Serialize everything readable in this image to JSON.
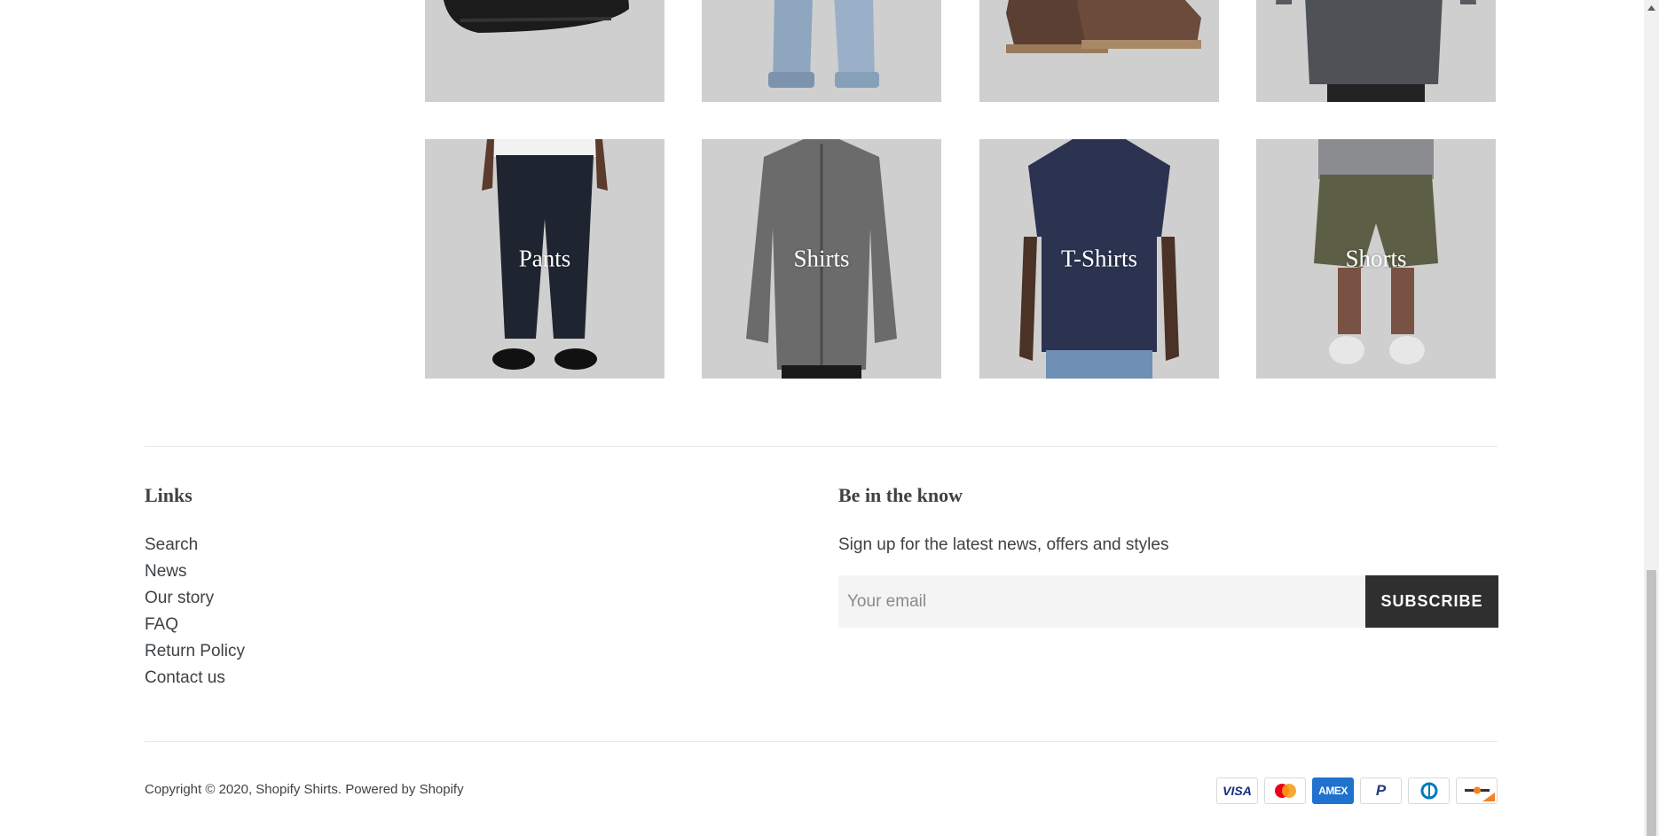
{
  "collections": {
    "row_top": [
      {
        "title": "",
        "image": "bag-photo"
      },
      {
        "title": "",
        "image": "jeans-photo"
      },
      {
        "title": "",
        "image": "boots-photo"
      },
      {
        "title": "",
        "image": "sweater-photo"
      }
    ],
    "row_bottom": [
      {
        "title": "Pants",
        "image": "pants-photo"
      },
      {
        "title": "Shirts",
        "image": "shirts-photo"
      },
      {
        "title": "T-Shirts",
        "image": "tshirts-photo"
      },
      {
        "title": "Shorts",
        "image": "shorts-photo"
      }
    ]
  },
  "footer": {
    "links": {
      "heading": "Links",
      "items": [
        "Search",
        "News",
        "Our story",
        "FAQ",
        "Return Policy",
        "Contact us"
      ]
    },
    "newsletter": {
      "heading": "Be in the know",
      "text": "Sign up for the latest news, offers and styles",
      "placeholder": "Your email",
      "button": "SUBSCRIBE"
    },
    "copyright": {
      "prefix": "Copyright © 2020, ",
      "store": "Shopify Shirts",
      "sep": ". ",
      "powered": "Powered by Shopify"
    },
    "payment_icons": [
      "visa",
      "master",
      "american_express",
      "paypal",
      "diners_club",
      "discover"
    ],
    "payment_labels": {
      "visa": "VISA",
      "amex": "AMEX",
      "paypal": "P"
    }
  },
  "colors": {
    "tile_bg": "#cfcfcf",
    "text": "#3d4246",
    "button_bg": "#2f2f2f",
    "input_bg": "#f4f4f4",
    "amex_blue": "#1f72cd",
    "visa_blue": "#172b85",
    "mc_red": "#eb001b",
    "mc_orange": "#f79e1b"
  }
}
